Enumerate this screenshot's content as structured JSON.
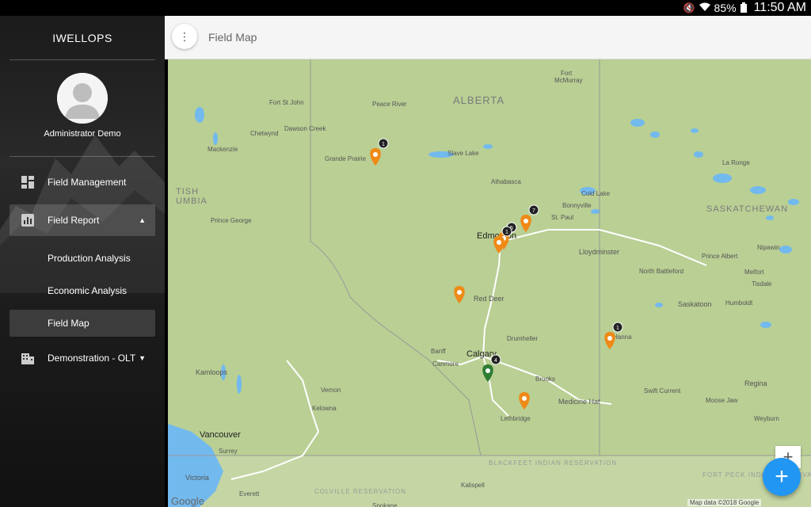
{
  "status_bar": {
    "battery_percent": "85%",
    "time": "11:50 AM",
    "icons": [
      "mute-icon",
      "wifi-icon",
      "battery-icon"
    ]
  },
  "sidebar": {
    "app_title": "IWELLOPS",
    "username": "Administrator Demo",
    "items": [
      {
        "label": "Field Management",
        "icon": "dashboard-icon"
      },
      {
        "label": "Field Report",
        "icon": "bar-chart-icon",
        "expanded": true
      },
      {
        "label": "Demonstration - OLT",
        "icon": "building-icon",
        "expanded": false
      }
    ],
    "sub_items": [
      {
        "label": "Production Analysis"
      },
      {
        "label": "Economic Analysis"
      },
      {
        "label": "Field Map",
        "selected": true
      }
    ]
  },
  "header": {
    "title": "Field Map"
  },
  "map": {
    "provider_logo": "Google",
    "attribution": "Map data ©2018 Google",
    "provinces": [
      "ALBERTA",
      "SASKATCHEWAN",
      "BRITISH COLUMBIA"
    ],
    "reservations": [
      "BLACKFEET INDIAN RESERVATION",
      "FORT PECK INDIAN RESERVATION",
      "COLVILLE RESERVATION"
    ],
    "cities": [
      "Fort McMurray",
      "Fort St John",
      "Peace River",
      "Dawson Creek",
      "Chetwynd",
      "Mackenzie",
      "Grande Prairie",
      "Slave Lake",
      "Athabasca",
      "Cold Lake",
      "Bonnyville",
      "St. Paul",
      "La Ronge",
      "Prince George",
      "Edmonton",
      "Lloydminster",
      "Prince Albert",
      "Nipawin",
      "North Battleford",
      "Melfort",
      "Tisdale",
      "Red Deer",
      "Saskatoon",
      "Humboldt",
      "Drumheller",
      "Hanna",
      "Banff",
      "Canmore",
      "Calgary",
      "Brooks",
      "Swift Current",
      "Kamloops",
      "Vernon",
      "Kelowna",
      "Medicine Hat",
      "Regina",
      "Moose Jaw",
      "Lethbridge",
      "Weyburn",
      "Vancouver",
      "Surrey",
      "Victoria",
      "Everett",
      "Kalispell",
      "Spokane"
    ],
    "markers": [
      {
        "type": "cluster",
        "count": "1",
        "color": "#ef8a16"
      },
      {
        "type": "cluster",
        "count": "7",
        "color": "#ef8a16"
      },
      {
        "type": "cluster",
        "count": "5",
        "color": "#ef8a16"
      },
      {
        "type": "cluster",
        "count": "1",
        "color": "#ef8a16"
      },
      {
        "type": "pin",
        "color": "#ef8a16"
      },
      {
        "type": "cluster",
        "count": "4",
        "color": "#2e7d32"
      },
      {
        "type": "pin",
        "color": "#ef8a16"
      },
      {
        "type": "cluster",
        "count": "1",
        "color": "#ef8a16"
      }
    ]
  },
  "controls": {
    "zoom_in_label": "+",
    "add_label": "+"
  },
  "colors": {
    "land": "#b9cf94",
    "water": "#72b9ee",
    "marker_orange": "#ef8a16",
    "marker_green": "#2e7d32",
    "fab": "#2196f3"
  }
}
